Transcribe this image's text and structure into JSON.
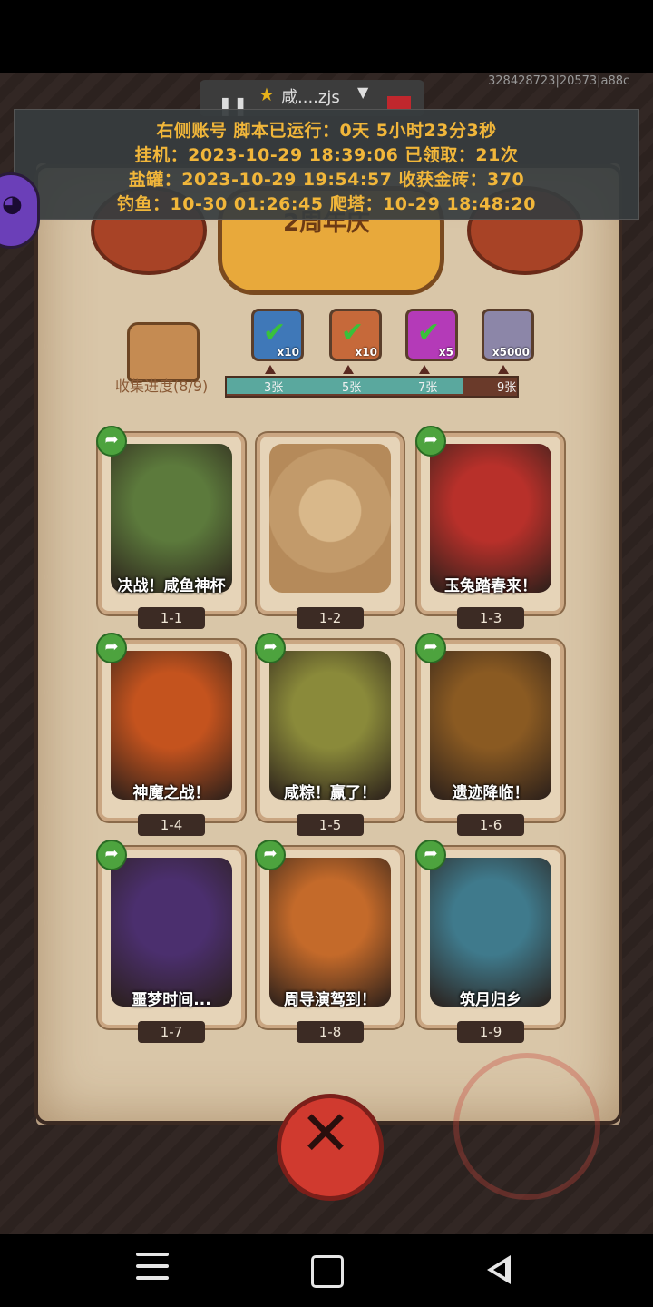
{
  "overlay": {
    "tab_title": "咸....zjs",
    "device_id": "328428723|20573|a88c",
    "lines": [
      "右侧账号 脚本已运行：0天 5小时23分3秒",
      "挂机：2023-10-29 18:39:06 已领取：21次",
      "盐罐：2023-10-29 19:54:57 收获金砖：370",
      "钓鱼：10-30 01:26:45 爬塔：10-29 18:48:20"
    ]
  },
  "header": {
    "banner_text": "2周年庆"
  },
  "collection": {
    "label": "收集进度(8/9)",
    "progress_fraction": 0.82,
    "rewards": [
      {
        "qty": "x10",
        "claimed": true,
        "color": "#3f78b8"
      },
      {
        "qty": "x10",
        "claimed": true,
        "color": "#c6693a"
      },
      {
        "qty": "x5",
        "claimed": true,
        "color": "#b43ab8"
      },
      {
        "qty": "x5000",
        "claimed": false,
        "color": "#8c86a8"
      }
    ],
    "milestones": [
      "3张",
      "5张",
      "7张",
      "9张"
    ]
  },
  "cards": [
    {
      "caption": "决战！咸鱼神杯",
      "stage": "1-1",
      "locked": false,
      "color": "#5c7a3c"
    },
    {
      "caption": "",
      "stage": "1-2",
      "locked": true,
      "color": "#c7a074"
    },
    {
      "caption": "玉兔踏春来！",
      "stage": "1-3",
      "locked": false,
      "color": "#b8302a"
    },
    {
      "caption": "神魔之战！",
      "stage": "1-4",
      "locked": false,
      "color": "#c4531e"
    },
    {
      "caption": "咸粽！赢了！",
      "stage": "1-5",
      "locked": false,
      "color": "#8a8a3a"
    },
    {
      "caption": "遗迹降临！",
      "stage": "1-6",
      "locked": false,
      "color": "#8a5a22"
    },
    {
      "caption": "噩梦时间...",
      "stage": "1-7",
      "locked": false,
      "color": "#4b2f6e"
    },
    {
      "caption": "周导演驾到！",
      "stage": "1-8",
      "locked": false,
      "color": "#c46a2a"
    },
    {
      "caption": "筑月归乡",
      "stage": "1-9",
      "locked": false,
      "color": "#3f7a8c"
    }
  ],
  "close_button": {
    "icon": "close-icon"
  },
  "navigation": {
    "icons": [
      "menu-icon",
      "home-icon",
      "back-icon"
    ]
  }
}
